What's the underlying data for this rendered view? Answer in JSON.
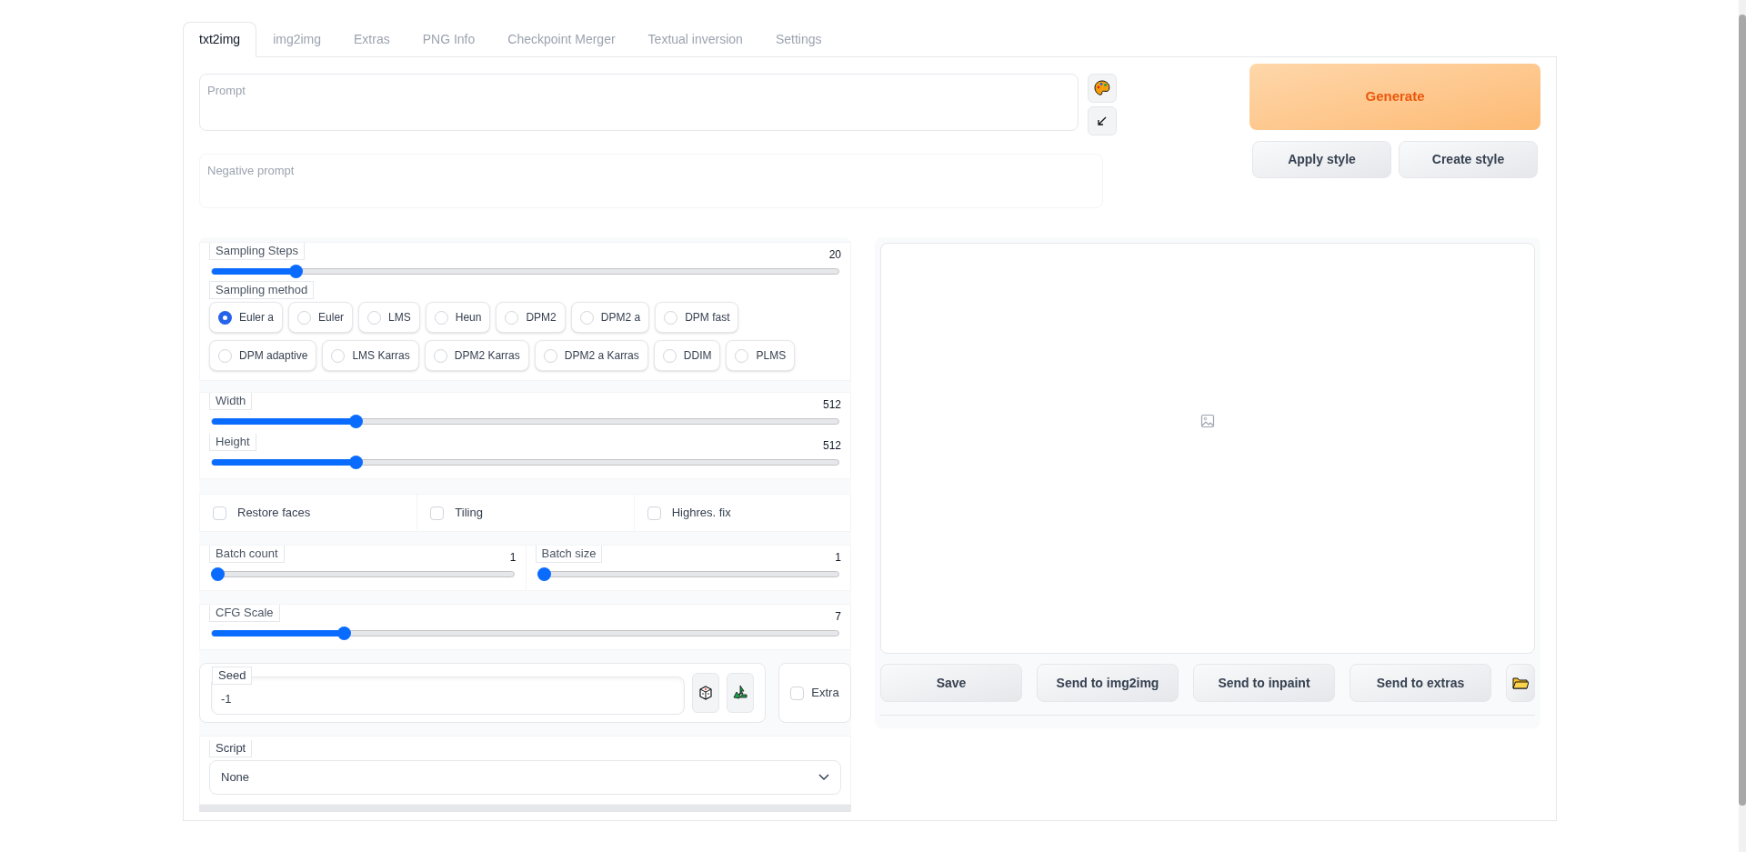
{
  "tabs": [
    {
      "label": "txt2img",
      "selected": true
    },
    {
      "label": "img2img",
      "selected": false
    },
    {
      "label": "Extras",
      "selected": false
    },
    {
      "label": "PNG Info",
      "selected": false
    },
    {
      "label": "Checkpoint Merger",
      "selected": false
    },
    {
      "label": "Textual inversion",
      "selected": false
    },
    {
      "label": "Settings",
      "selected": false
    }
  ],
  "prompt": {
    "placeholder": "Prompt"
  },
  "negative_prompt": {
    "placeholder": "Negative prompt"
  },
  "generate_button": "Generate",
  "style_buttons": [
    "Apply style",
    "Create style"
  ],
  "sampling_steps": {
    "label": "Sampling Steps",
    "value": "20",
    "level": 0.134
  },
  "sampling_method": {
    "label": "Sampling method",
    "options": [
      {
        "label": "Euler a",
        "selected": true
      },
      {
        "label": "Euler",
        "selected": false
      },
      {
        "label": "LMS",
        "selected": false
      },
      {
        "label": "Heun",
        "selected": false
      },
      {
        "label": "DPM2",
        "selected": false
      },
      {
        "label": "DPM2 a",
        "selected": false
      },
      {
        "label": "DPM fast",
        "selected": false
      },
      {
        "label": "DPM adaptive",
        "selected": false
      },
      {
        "label": "LMS Karras",
        "selected": false
      },
      {
        "label": "DPM2 Karras",
        "selected": false
      },
      {
        "label": "DPM2 a Karras",
        "selected": false
      },
      {
        "label": "DDIM",
        "selected": false
      },
      {
        "label": "PLMS",
        "selected": false
      }
    ]
  },
  "size_sliders": [
    {
      "label": "Width",
      "value": "512",
      "level": 0.23
    },
    {
      "label": "Height",
      "value": "512",
      "level": 0.23
    }
  ],
  "checkboxes": [
    {
      "label": "Restore faces",
      "checked": false
    },
    {
      "label": "Tiling",
      "checked": false
    },
    {
      "label": "Highres. fix",
      "checked": false
    }
  ],
  "batch_sliders": [
    {
      "label": "Batch count",
      "value": "1",
      "level": 0
    },
    {
      "label": "Batch size",
      "value": "1",
      "level": 0
    }
  ],
  "cfg_scale": {
    "label": "CFG Scale",
    "value": "7",
    "level": 0.21
  },
  "seed": {
    "label": "Seed",
    "value": "-1"
  },
  "extra": {
    "label": "Extra",
    "checked": false
  },
  "script": {
    "label": "Script",
    "value": "None"
  },
  "output_buttons": [
    "Save",
    "Send to img2img",
    "Send to inpaint",
    "Send to extras"
  ]
}
